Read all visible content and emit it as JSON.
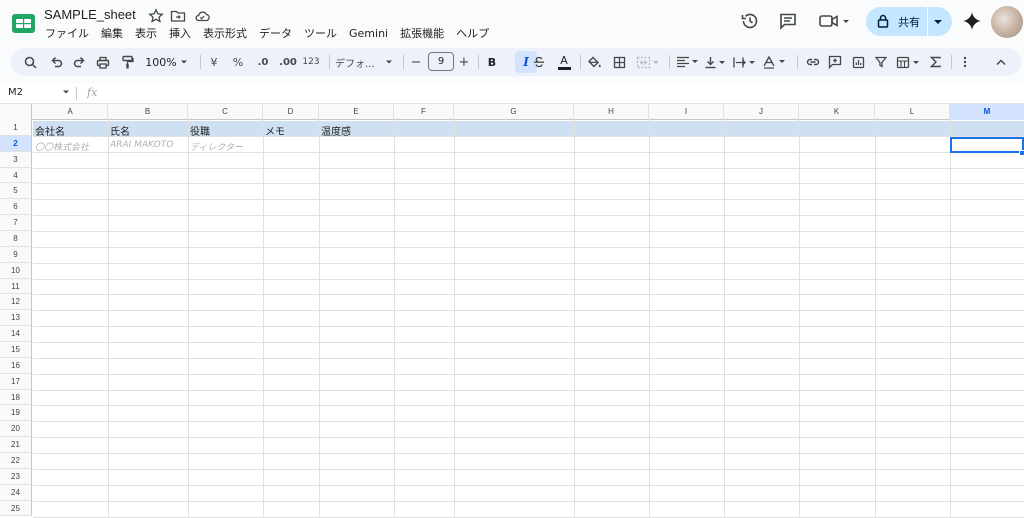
{
  "app": {
    "title": "SAMPLE_sheet",
    "menu": [
      "ファイル",
      "編集",
      "表示",
      "挿入",
      "表示形式",
      "データ",
      "ツール",
      "Gemini",
      "拡張機能",
      "ヘルプ"
    ],
    "share_label": "共有"
  },
  "toolbar": {
    "zoom": "100%",
    "currency": "¥",
    "percent": "%",
    "dec_decrease": ".0",
    "dec_increase": ".00",
    "number_format": "123",
    "font": "デフォ...",
    "font_size": "9",
    "minus": "−",
    "plus": "+",
    "bold": "B",
    "italic": "I",
    "text_color": "A",
    "active_style": "italic"
  },
  "formula_bar": {
    "cell_ref": "M2",
    "fx": "fx",
    "value": ""
  },
  "sheet": {
    "columns": [
      "A",
      "B",
      "C",
      "D",
      "E",
      "F",
      "G",
      "H",
      "I",
      "J",
      "K",
      "L",
      "M"
    ],
    "selected_column": "M",
    "selected_row": "2",
    "rows": [
      "1",
      "2",
      "3",
      "4",
      "5",
      "6",
      "7",
      "8",
      "9",
      "10",
      "11",
      "12",
      "13",
      "14",
      "15",
      "16",
      "17",
      "18",
      "19",
      "20",
      "21",
      "22",
      "23",
      "24",
      "25"
    ],
    "header_row": {
      "A": "会社名",
      "B": "氏名",
      "C": "役職",
      "D": "メモ",
      "E": "温度感"
    },
    "placeholder_row": {
      "A": "〇〇株式会社",
      "B": "ARAI MAKOTO",
      "C": "ディレクター"
    }
  },
  "colors": {
    "accent": "#0b57d0",
    "header_row_fill": "#cfe0f2",
    "selection_border": "#1a73e8",
    "share_button": "#c2e7ff"
  }
}
